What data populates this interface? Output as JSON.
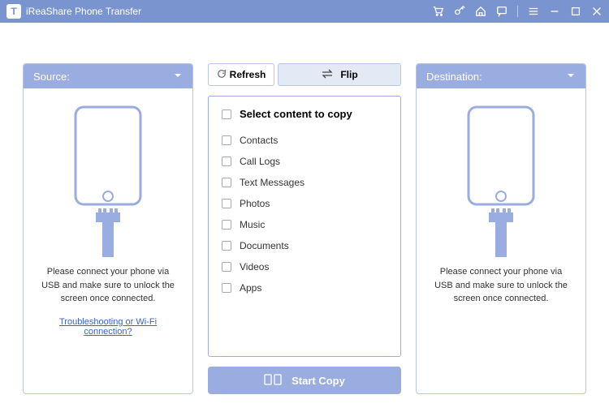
{
  "app": {
    "title": "iReaShare Phone Transfer",
    "logo_letter": "T"
  },
  "source": {
    "header": "Source:",
    "connect_text": "Please connect your phone via USB and make sure to unlock the screen once connected.",
    "troubleshoot": "Troubleshooting or Wi-Fi connection?"
  },
  "destination": {
    "header": "Destination:",
    "connect_text": "Please connect your phone via USB and make sure to unlock the screen once connected."
  },
  "center": {
    "refresh": "Refresh",
    "flip": "Flip",
    "select_label": "Select content to copy",
    "items": [
      "Contacts",
      "Call Logs",
      "Text Messages",
      "Photos",
      "Music",
      "Documents",
      "Videos",
      "Apps"
    ],
    "start": "Start Copy"
  }
}
